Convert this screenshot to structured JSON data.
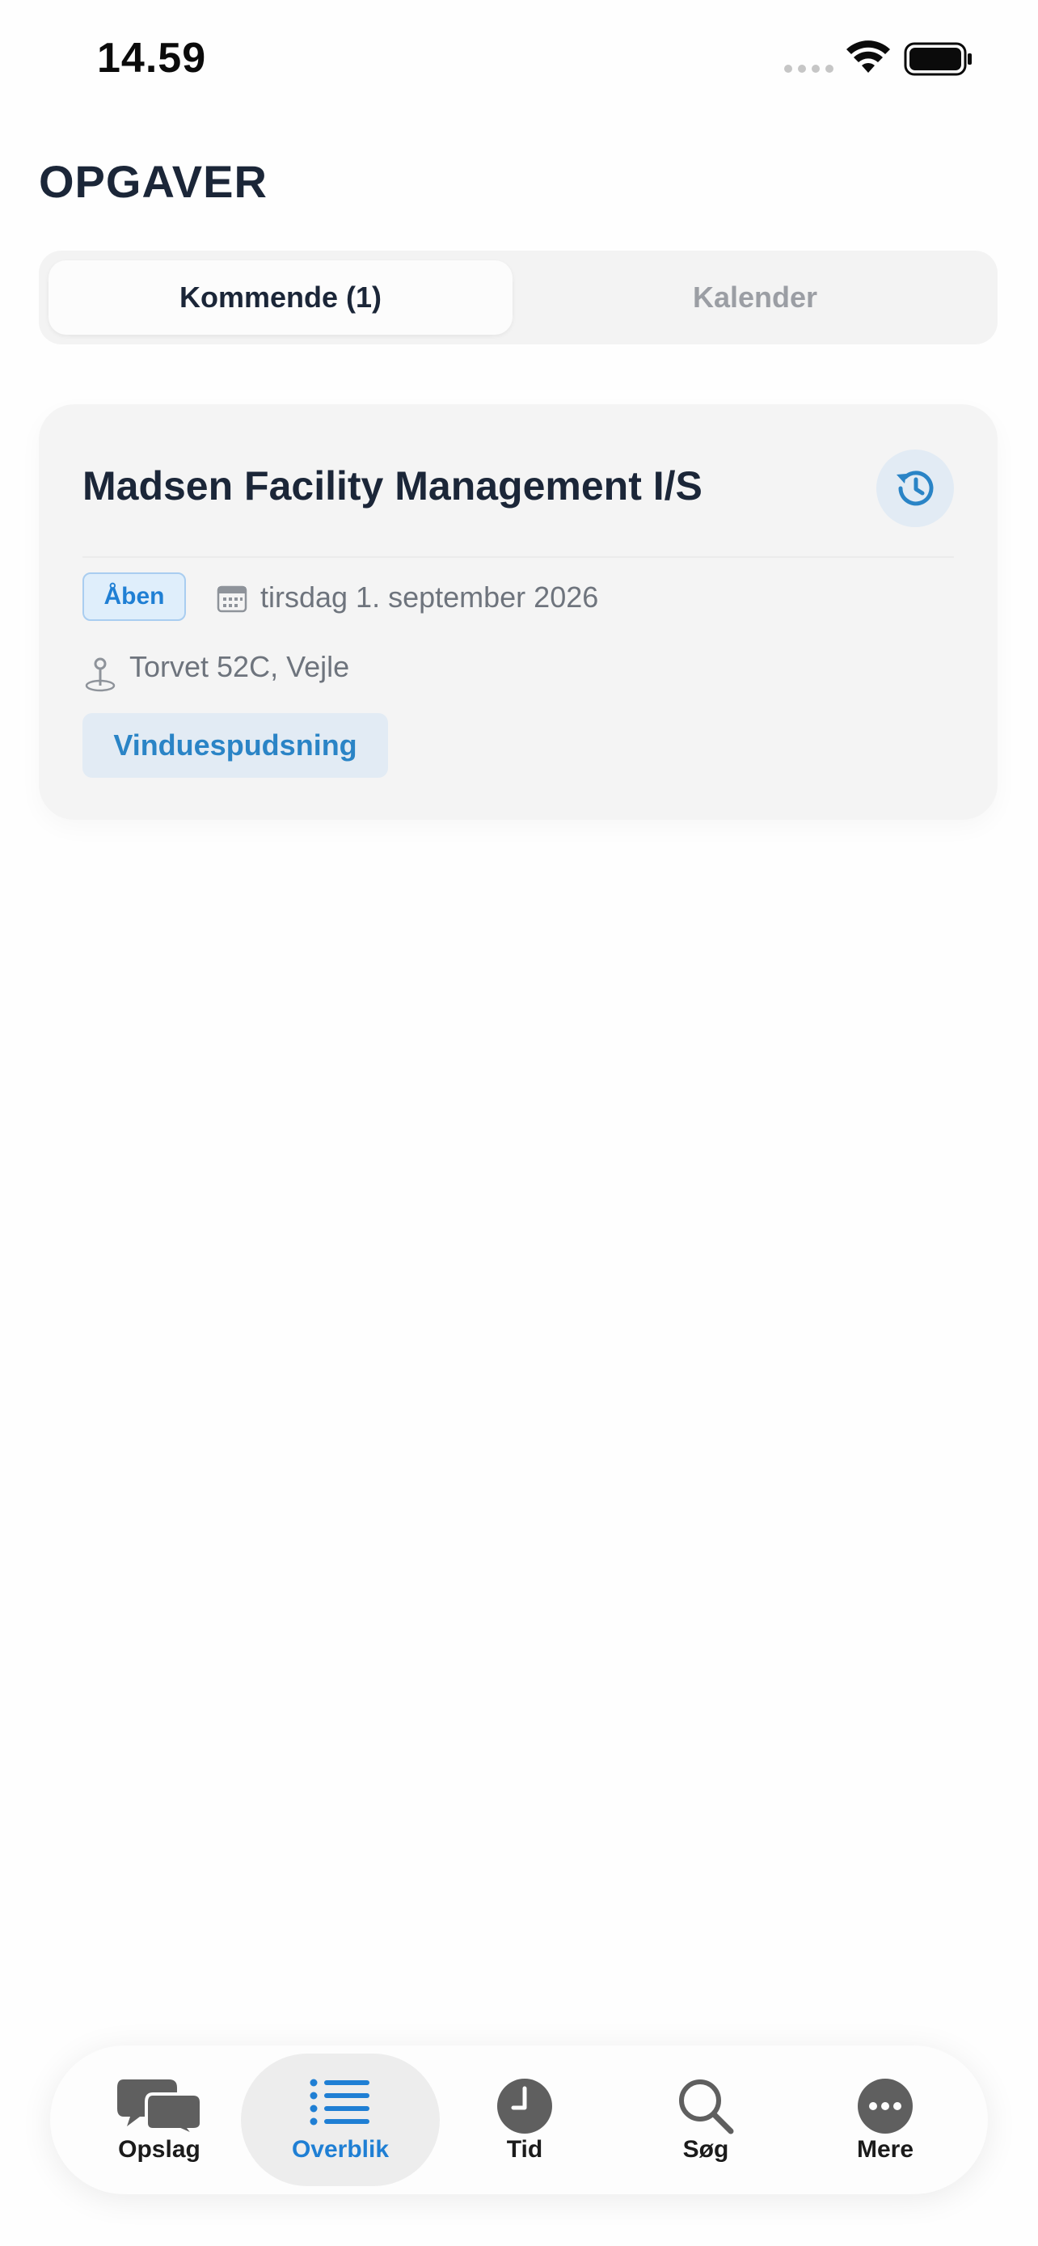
{
  "status_bar": {
    "time": "14.59"
  },
  "page": {
    "title": "OPGAVER"
  },
  "segmented": {
    "upcoming_label": "Kommende (1)",
    "calendar_label": "Kalender"
  },
  "task": {
    "company": "Madsen Facility Management I/S",
    "status": "Åben",
    "date": "tirsdag 1. september 2026",
    "address": "Torvet 52C, Vejle",
    "tag": "Vinduespudsning"
  },
  "tab_bar": {
    "items": [
      {
        "label": "Opslag",
        "icon": "chat-bubbles-icon"
      },
      {
        "label": "Overblik",
        "icon": "list-icon",
        "selected": true
      },
      {
        "label": "Tid",
        "icon": "clock-icon"
      },
      {
        "label": "Søg",
        "icon": "search-icon"
      },
      {
        "label": "Mere",
        "icon": "more-icon"
      }
    ]
  },
  "colors": {
    "accent": "#1f7fd4",
    "title": "#1b2638",
    "muted": "#6e747d",
    "card": "#f4f4f4"
  }
}
